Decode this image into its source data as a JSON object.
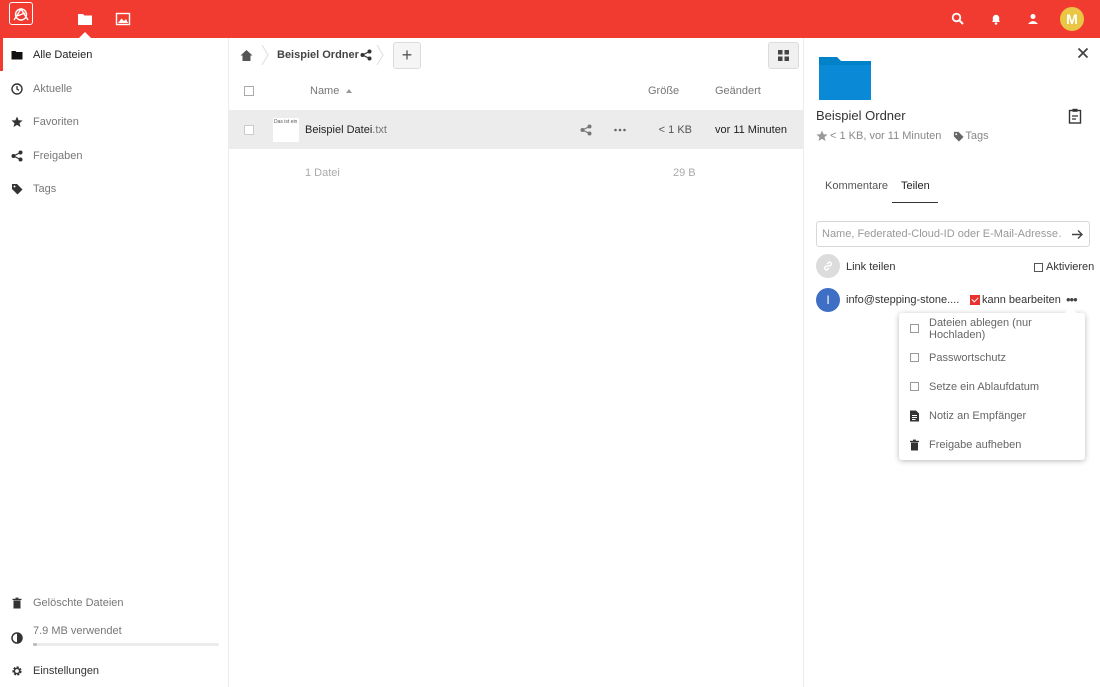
{
  "header": {
    "apps": [
      {
        "name": "files",
        "icon": "folder-icon"
      },
      {
        "name": "photos",
        "icon": "image-icon"
      }
    ],
    "avatar_letter": "M",
    "colors": {
      "brand": "#f13b30",
      "avatar": "#e9c744"
    }
  },
  "sidebar": {
    "items": [
      {
        "label": "Alle Dateien",
        "icon": "folder-icon"
      },
      {
        "label": "Aktuelle",
        "icon": "clock-icon"
      },
      {
        "label": "Favoriten",
        "icon": "star-icon"
      },
      {
        "label": "Freigaben",
        "icon": "share-icon"
      },
      {
        "label": "Tags",
        "icon": "tag-icon"
      }
    ],
    "trash_label": "Gelöschte Dateien",
    "quota_label": "7.9 MB verwendet",
    "quota_fraction": 0.02,
    "settings_label": "Einstellungen"
  },
  "breadcrumb": {
    "folder": "Beispiel Ordner"
  },
  "table": {
    "headers": {
      "name": "Name",
      "size": "Größe",
      "modified": "Geändert"
    },
    "rows": [
      {
        "name": "Beispiel Datei",
        "ext": ".txt",
        "preview_text": "Das ist ein",
        "size": "< 1 KB",
        "modified": "vor 11 Minuten"
      }
    ],
    "summary": {
      "count": "1 Datei",
      "size": "29 B"
    }
  },
  "panel": {
    "title": "Beispiel Ordner",
    "meta": "< 1 KB, vor 11 Minuten",
    "tags_label": "Tags",
    "tabs": [
      {
        "label": "Kommentare"
      },
      {
        "label": "Teilen",
        "active": true
      }
    ],
    "share_placeholder": "Name, Federated-Cloud-ID oder E-Mail-Adresse…",
    "link_label": "Link teilen",
    "activate_label": "Aktivieren",
    "share_user": {
      "initial": "I",
      "email": "info@stepping-stone....",
      "permission_label": "kann bearbeiten",
      "color": "#3f6fc4"
    }
  },
  "popover": {
    "items": [
      {
        "label": "Dateien ablegen (nur Hochladen)",
        "type": "checkbox"
      },
      {
        "label": "Passwortschutz",
        "type": "checkbox"
      },
      {
        "label": "Setze ein Ablaufdatum",
        "type": "checkbox"
      },
      {
        "label": "Notiz an Empfänger",
        "type": "note"
      },
      {
        "label": "Freigabe aufheben",
        "type": "trash"
      }
    ]
  }
}
